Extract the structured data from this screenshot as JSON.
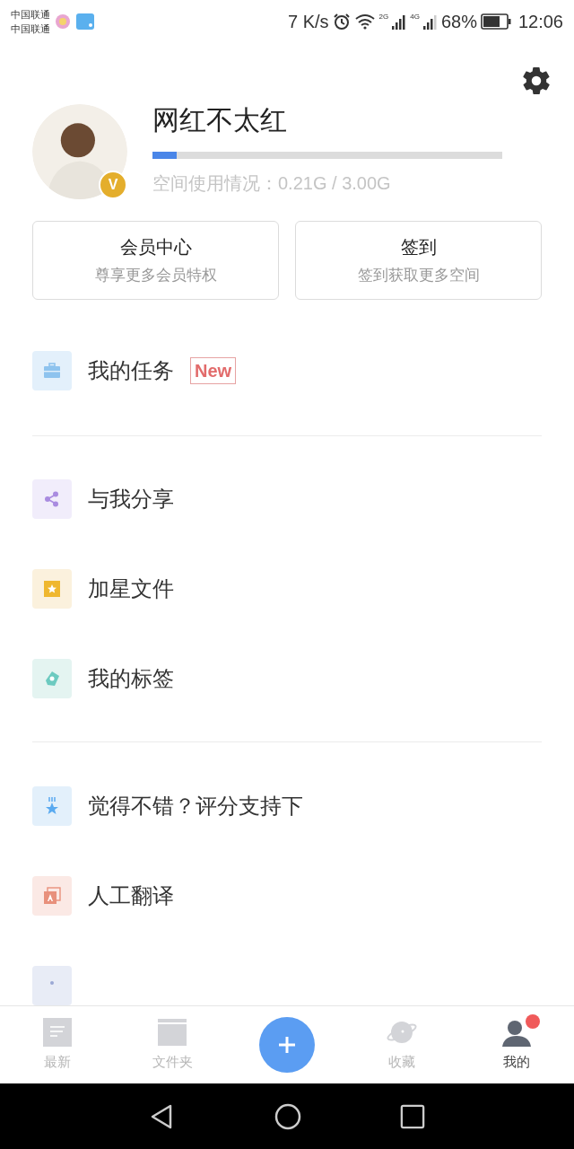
{
  "status_bar": {
    "carriers": [
      "中国联通",
      "中国联通"
    ],
    "speed": "7 K/s",
    "network_1": "2G",
    "network_2": "4G",
    "battery": "68%",
    "time": "12:06"
  },
  "profile": {
    "name": "网红不太红",
    "vip_badge": "V",
    "storage": {
      "level": 0.07,
      "label": "空间使用情况：0.21G / 3.00G"
    }
  },
  "cards": [
    {
      "title": "会员中心",
      "subtitle": "尊享更多会员特权"
    },
    {
      "title": "签到",
      "subtitle": "签到获取更多空间"
    }
  ],
  "menu_groups": [
    [
      {
        "kind": "tasks",
        "label": "我的任务",
        "tag": "New"
      }
    ],
    [
      {
        "kind": "share",
        "label": "与我分享"
      },
      {
        "kind": "star",
        "label": "加星文件"
      },
      {
        "kind": "tag",
        "label": "我的标签"
      }
    ],
    [
      {
        "kind": "rate",
        "label": "觉得不错？评分支持下"
      },
      {
        "kind": "translate",
        "label": "人工翻译"
      },
      {
        "kind": "message"
      }
    ]
  ],
  "tab_bar": [
    {
      "kind": "recent",
      "label": "最新",
      "selected": false,
      "badge": false
    },
    {
      "kind": "folder",
      "label": "文件夹",
      "selected": false,
      "badge": false
    },
    {
      "kind": "add"
    },
    {
      "kind": "favorites",
      "label": "收藏",
      "selected": false,
      "badge": false
    },
    {
      "kind": "me",
      "label": "我的",
      "selected": true,
      "badge": true
    }
  ]
}
